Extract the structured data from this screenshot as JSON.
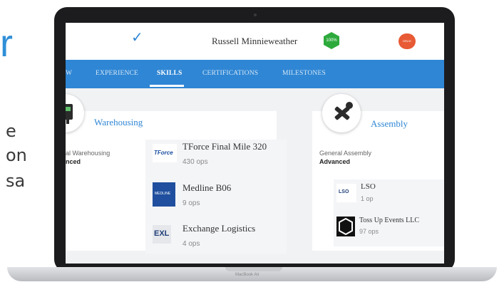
{
  "side": {
    "letter": "r",
    "lines": [
      "e",
      "on",
      "sa"
    ]
  },
  "header": {
    "user_name": "Russell Minnieweather",
    "shield_badge": "100%",
    "drug_badge": "DRUG SCREEN"
  },
  "tabs": [
    {
      "label": "W",
      "active": false
    },
    {
      "label": "EXPERIENCE",
      "active": false
    },
    {
      "label": "SKILLS",
      "active": true
    },
    {
      "label": "CERTIFICATIONS",
      "active": false
    },
    {
      "label": "MILESTONES",
      "active": false
    }
  ],
  "skills": {
    "warehousing": {
      "title": "Warehousing",
      "subtitle": "al Warehousing",
      "level": "nced",
      "companies": [
        {
          "logo": "TForce",
          "name": "TForce Final Mile 320",
          "ops": "430 ops"
        },
        {
          "logo": "MEDLINE",
          "name": "Medline B06",
          "ops": "9 ops"
        },
        {
          "logo": "EXL",
          "name": "Exchange Logistics",
          "ops": "4 ops"
        }
      ]
    },
    "assembly": {
      "title": "Assembly",
      "subtitle": "General Assembly",
      "level": "Advanced",
      "companies": [
        {
          "logo": "LSO",
          "name": "LSO",
          "ops": "1 op"
        },
        {
          "logo": "toss-up-logo",
          "name": "Toss Up Events LLC",
          "ops": "97 ops"
        }
      ]
    }
  },
  "device": {
    "label": "MacBook Air"
  },
  "colors": {
    "accent": "#2f86d4",
    "shield": "#2eaa3c",
    "drug": "#e85a35"
  }
}
